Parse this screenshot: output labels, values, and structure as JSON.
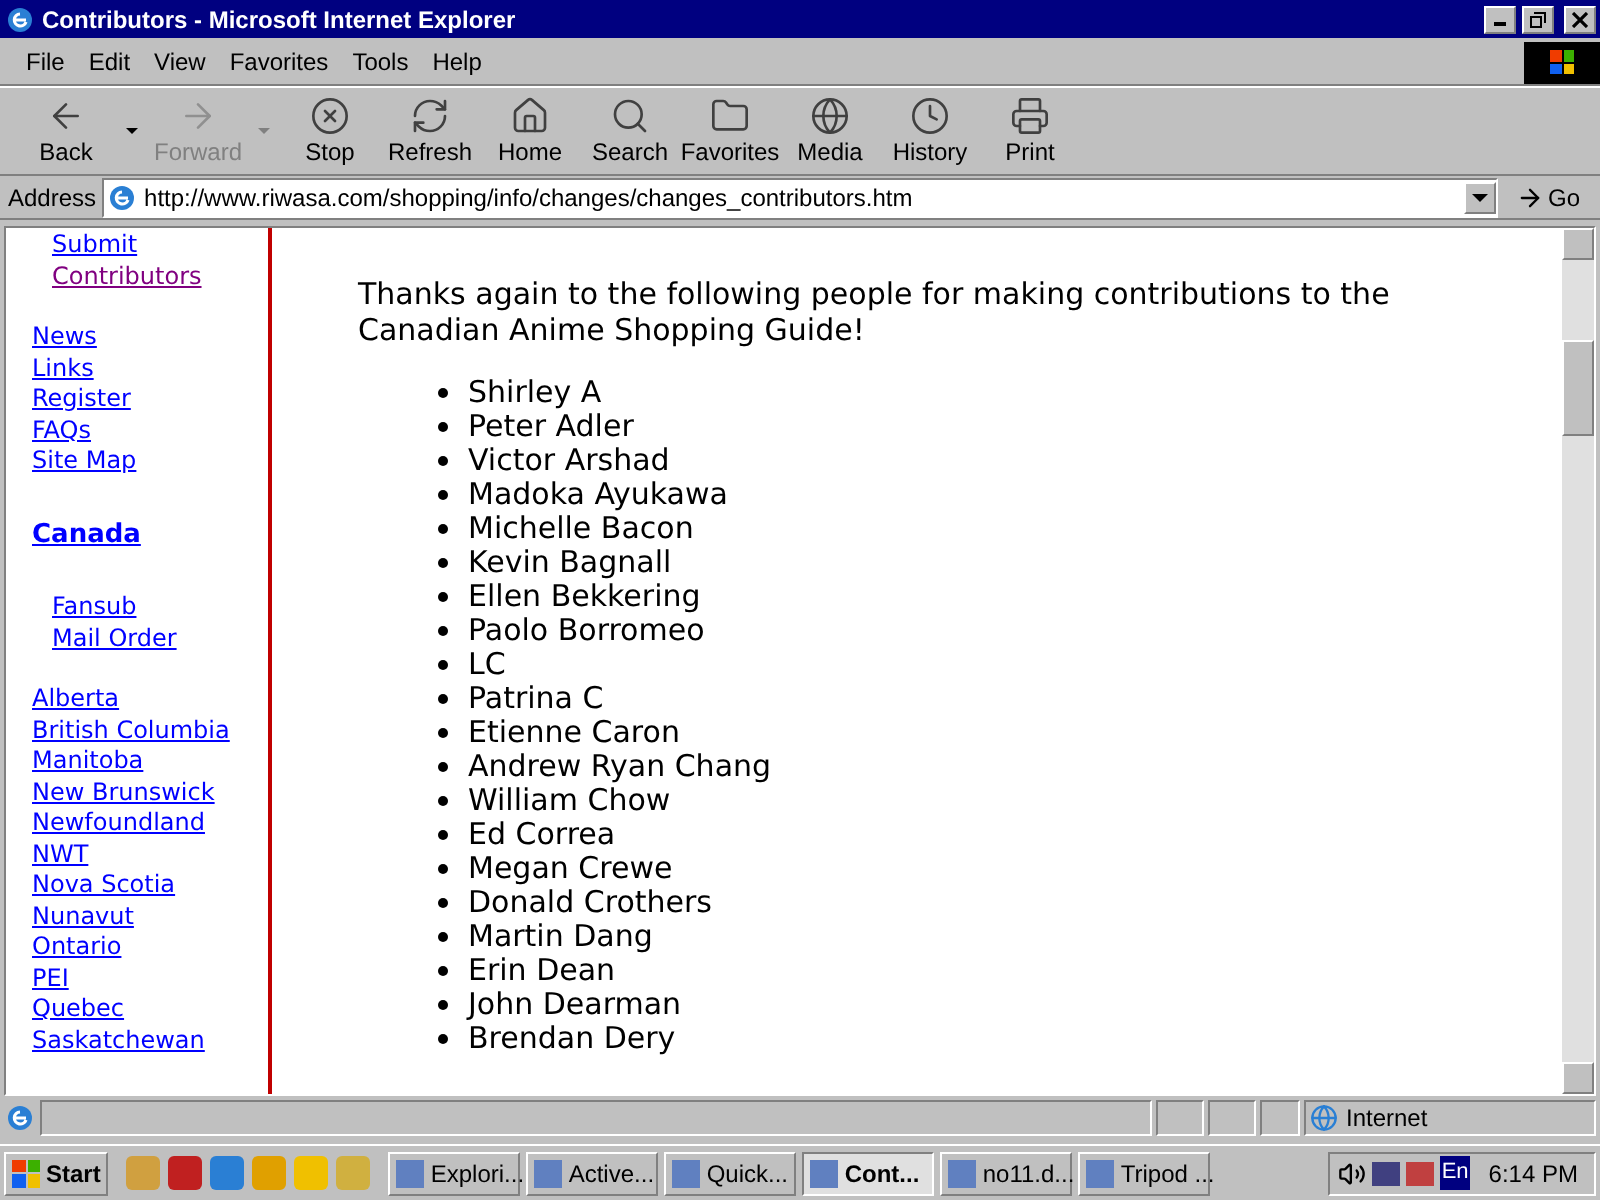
{
  "window": {
    "title": "Contributors - Microsoft Internet Explorer"
  },
  "menu": [
    "File",
    "Edit",
    "View",
    "Favorites",
    "Tools",
    "Help"
  ],
  "toolbar": [
    {
      "label": "Back",
      "disabled": false,
      "dropdown": true
    },
    {
      "label": "Forward",
      "disabled": true,
      "dropdown": true
    },
    {
      "label": "Stop",
      "disabled": false,
      "dropdown": false
    },
    {
      "label": "Refresh",
      "disabled": false,
      "dropdown": false
    },
    {
      "label": "Home",
      "disabled": false,
      "dropdown": false
    },
    {
      "label": "Search",
      "disabled": false,
      "dropdown": false
    },
    {
      "label": "Favorites",
      "disabled": false,
      "dropdown": false
    },
    {
      "label": "Media",
      "disabled": false,
      "dropdown": false
    },
    {
      "label": "History",
      "disabled": false,
      "dropdown": false
    },
    {
      "label": "Print",
      "disabled": false,
      "dropdown": false
    }
  ],
  "address": {
    "label": "Address",
    "value": "http://www.riwasa.com/shopping/info/changes/changes_contributors.htm",
    "go": "Go"
  },
  "sidebar": [
    [
      {
        "label": "Submit",
        "kind": "sub",
        "visited": false
      },
      {
        "label": "Contributors",
        "kind": "sub",
        "visited": true
      }
    ],
    [
      {
        "label": "News",
        "kind": "link",
        "visited": false
      },
      {
        "label": "Links",
        "kind": "link",
        "visited": false
      },
      {
        "label": "Register",
        "kind": "link",
        "visited": false
      },
      {
        "label": "FAQs",
        "kind": "link",
        "visited": false
      },
      {
        "label": "Site Map",
        "kind": "link",
        "visited": false
      }
    ],
    [
      {
        "label": "Canada",
        "kind": "heading",
        "visited": false
      }
    ],
    [
      {
        "label": "Fansub",
        "kind": "sub",
        "visited": false
      },
      {
        "label": "Mail Order",
        "kind": "sub",
        "visited": false
      }
    ],
    [
      {
        "label": "Alberta",
        "kind": "link",
        "visited": false
      },
      {
        "label": "British Columbia",
        "kind": "link",
        "visited": false
      },
      {
        "label": "Manitoba",
        "kind": "link",
        "visited": false
      },
      {
        "label": "New Brunswick",
        "kind": "link",
        "visited": false
      },
      {
        "label": "Newfoundland",
        "kind": "link",
        "visited": false
      },
      {
        "label": "NWT",
        "kind": "link",
        "visited": false
      },
      {
        "label": "Nova Scotia",
        "kind": "link",
        "visited": false
      },
      {
        "label": "Nunavut",
        "kind": "link",
        "visited": false
      },
      {
        "label": "Ontario",
        "kind": "link",
        "visited": false
      },
      {
        "label": "PEI",
        "kind": "link",
        "visited": false
      },
      {
        "label": "Quebec",
        "kind": "link",
        "visited": false
      },
      {
        "label": "Saskatchewan",
        "kind": "link",
        "visited": false
      }
    ]
  ],
  "content": {
    "intro": "Thanks again to the following people for making contributions to the Canadian Anime Shopping Guide!",
    "contributors": [
      "Shirley A",
      "Peter Adler",
      "Victor Arshad",
      "Madoka Ayukawa",
      "Michelle Bacon",
      "Kevin Bagnall",
      "Ellen Bekkering",
      "Paolo Borromeo",
      "LC",
      "Patrina C",
      "Etienne Caron",
      "Andrew Ryan Chang",
      "William Chow",
      "Ed Correa",
      "Megan Crewe",
      "Donald Crothers",
      "Martin Dang",
      "Erin Dean",
      "John Dearman",
      "Brendan Dery"
    ]
  },
  "status_bar": {
    "zone": "Internet"
  },
  "taskbar": {
    "start": "Start",
    "tasks": [
      {
        "label": "Explori...",
        "selected": false
      },
      {
        "label": "Active...",
        "selected": false
      },
      {
        "label": "Quick...",
        "selected": false
      },
      {
        "label": "Cont...",
        "selected": true
      },
      {
        "label": "no11.d...",
        "selected": false
      },
      {
        "label": "Tripod ...",
        "selected": false
      }
    ],
    "language": "En",
    "clock": "6:14 PM"
  }
}
